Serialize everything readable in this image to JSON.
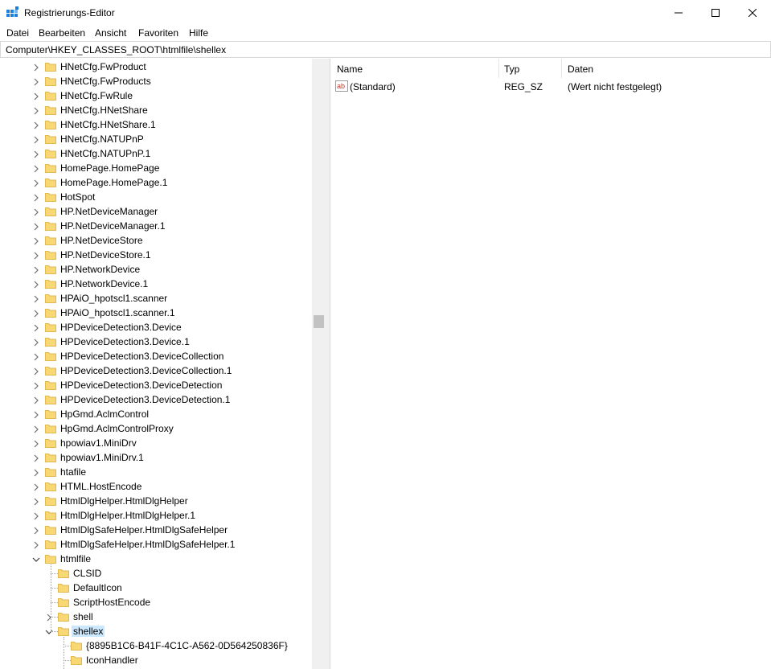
{
  "window": {
    "title": "Registrierungs-Editor"
  },
  "menu": [
    "Datei",
    "Bearbeiten",
    "Ansicht",
    "Favoriten",
    "Hilfe"
  ],
  "address": "Computer\\HKEY_CLASSES_ROOT\\htmlfile\\shellex",
  "tree": {
    "top_items": [
      "HNetCfg.FwProduct",
      "HNetCfg.FwProducts",
      "HNetCfg.FwRule",
      "HNetCfg.HNetShare",
      "HNetCfg.HNetShare.1",
      "HNetCfg.NATUPnP",
      "HNetCfg.NATUPnP.1",
      "HomePage.HomePage",
      "HomePage.HomePage.1",
      "HotSpot",
      "HP.NetDeviceManager",
      "HP.NetDeviceManager.1",
      "HP.NetDeviceStore",
      "HP.NetDeviceStore.1",
      "HP.NetworkDevice",
      "HP.NetworkDevice.1",
      "HPAiO_hpotscl1.scanner",
      "HPAiO_hpotscl1.scanner.1",
      "HPDeviceDetection3.Device",
      "HPDeviceDetection3.Device.1",
      "HPDeviceDetection3.DeviceCollection",
      "HPDeviceDetection3.DeviceCollection.1",
      "HPDeviceDetection3.DeviceDetection",
      "HPDeviceDetection3.DeviceDetection.1",
      "HpGmd.AclmControl",
      "HpGmd.AclmControlProxy",
      "hpowiav1.MiniDrv",
      "hpowiav1.MiniDrv.1",
      "htafile",
      "HTML.HostEncode",
      "HtmlDlgHelper.HtmlDlgHelper",
      "HtmlDlgHelper.HtmlDlgHelper.1",
      "HtmlDlgSafeHelper.HtmlDlgSafeHelper",
      "HtmlDlgSafeHelper.HtmlDlgSafeHelper.1",
      "htmlfile"
    ],
    "htmlfile_children": [
      "CLSID",
      "DefaultIcon",
      "ScriptHostEncode",
      "shell",
      "shellex"
    ],
    "shellex_children": [
      "{8895B1C6-B41F-4C1C-A562-0D564250836F}",
      "IconHandler"
    ],
    "selected": "shellex"
  },
  "list": {
    "columns": [
      "Name",
      "Typ",
      "Daten"
    ],
    "rows": [
      {
        "icon": "string-value-icon",
        "icon_text": "ab",
        "name": "(Standard)",
        "type": "REG_SZ",
        "data": "(Wert nicht festgelegt)"
      }
    ]
  },
  "colors": {
    "folder": "#f8d775",
    "selection": "#cce8ff",
    "app_icon": "#1e7fd8"
  }
}
